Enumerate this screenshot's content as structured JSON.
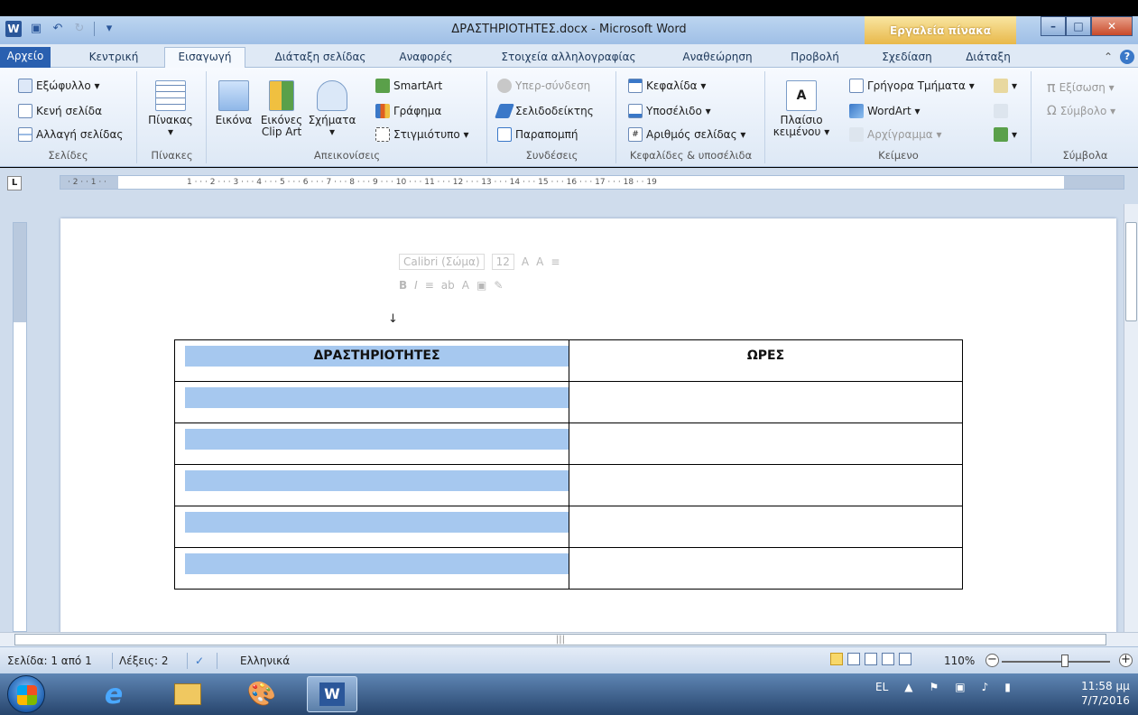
{
  "window": {
    "title": "ΔΡΑΣΤΗΡΙΟΤΗΤΕΣ.docx - Microsoft Word",
    "context_tab_group": "Εργαλεία πίνακα"
  },
  "tabs": [
    "Αρχείο",
    "Κεντρική",
    "Εισαγωγή",
    "Διάταξη σελίδας",
    "Αναφορές",
    "Στοιχεία αλληλογραφίας",
    "Αναθεώρηση",
    "Προβολή",
    "Σχεδίαση",
    "Διάταξη"
  ],
  "ribbon": {
    "pages": {
      "items": [
        "Εξώφυλλο ▾",
        "Κενή σελίδα",
        "Αλλαγή σελίδας"
      ],
      "label": "Σελίδες"
    },
    "tables": {
      "button": "Πίνακας",
      "label": "Πίνακες"
    },
    "illustrations": {
      "picture": "Εικόνα",
      "clipart": "Εικόνες Clip Art",
      "shapes": "Σχήματα",
      "smartart": "SmartArt",
      "chart": "Γράφημα",
      "screenshot": "Στιγμιότυπο ▾",
      "label": "Απεικονίσεις"
    },
    "links": {
      "hyperlink": "Υπερ-σύνδεση",
      "bookmark": "Σελιδοδείκτης",
      "crossref": "Παραπομπή",
      "label": "Συνδέσεις"
    },
    "headerfooter": {
      "header": "Κεφαλίδα ▾",
      "footer": "Υποσέλιδο ▾",
      "pagenum": "Αριθμός σελίδας ▾",
      "label": "Κεφαλίδες & υποσέλιδα"
    },
    "text": {
      "textbox": "Πλαίσιο κειμένου ▾",
      "quickparts": "Γρήγορα Τμήματα ▾",
      "wordart": "WordArt ▾",
      "dropcap": "Αρχίγραμμα ▾",
      "label": "Κείμενο"
    },
    "symbols": {
      "equation": "Εξίσωση ▾",
      "symbol": "Σύμβολο ▾",
      "label": "Σύμβολα"
    }
  },
  "minitoolbar": {
    "font": "Calibri (Σώμα)",
    "size": "12"
  },
  "table": {
    "headers": [
      "ΔΡΑΣΤΗΡΙΟΤΗΤΕΣ",
      "ΩΡΕΣ"
    ],
    "rows": [
      [
        "",
        ""
      ],
      [
        "",
        ""
      ],
      [
        "",
        ""
      ],
      [
        "",
        ""
      ],
      [
        "",
        ""
      ]
    ]
  },
  "status": {
    "page": "Σελίδα: 1 από 1",
    "words": "Λέξεις: 2",
    "language": "Ελληνικά",
    "zoom": "110%"
  },
  "taskbar": {
    "lang": "EL",
    "time": "11:58 μμ",
    "date": "7/7/2016"
  }
}
